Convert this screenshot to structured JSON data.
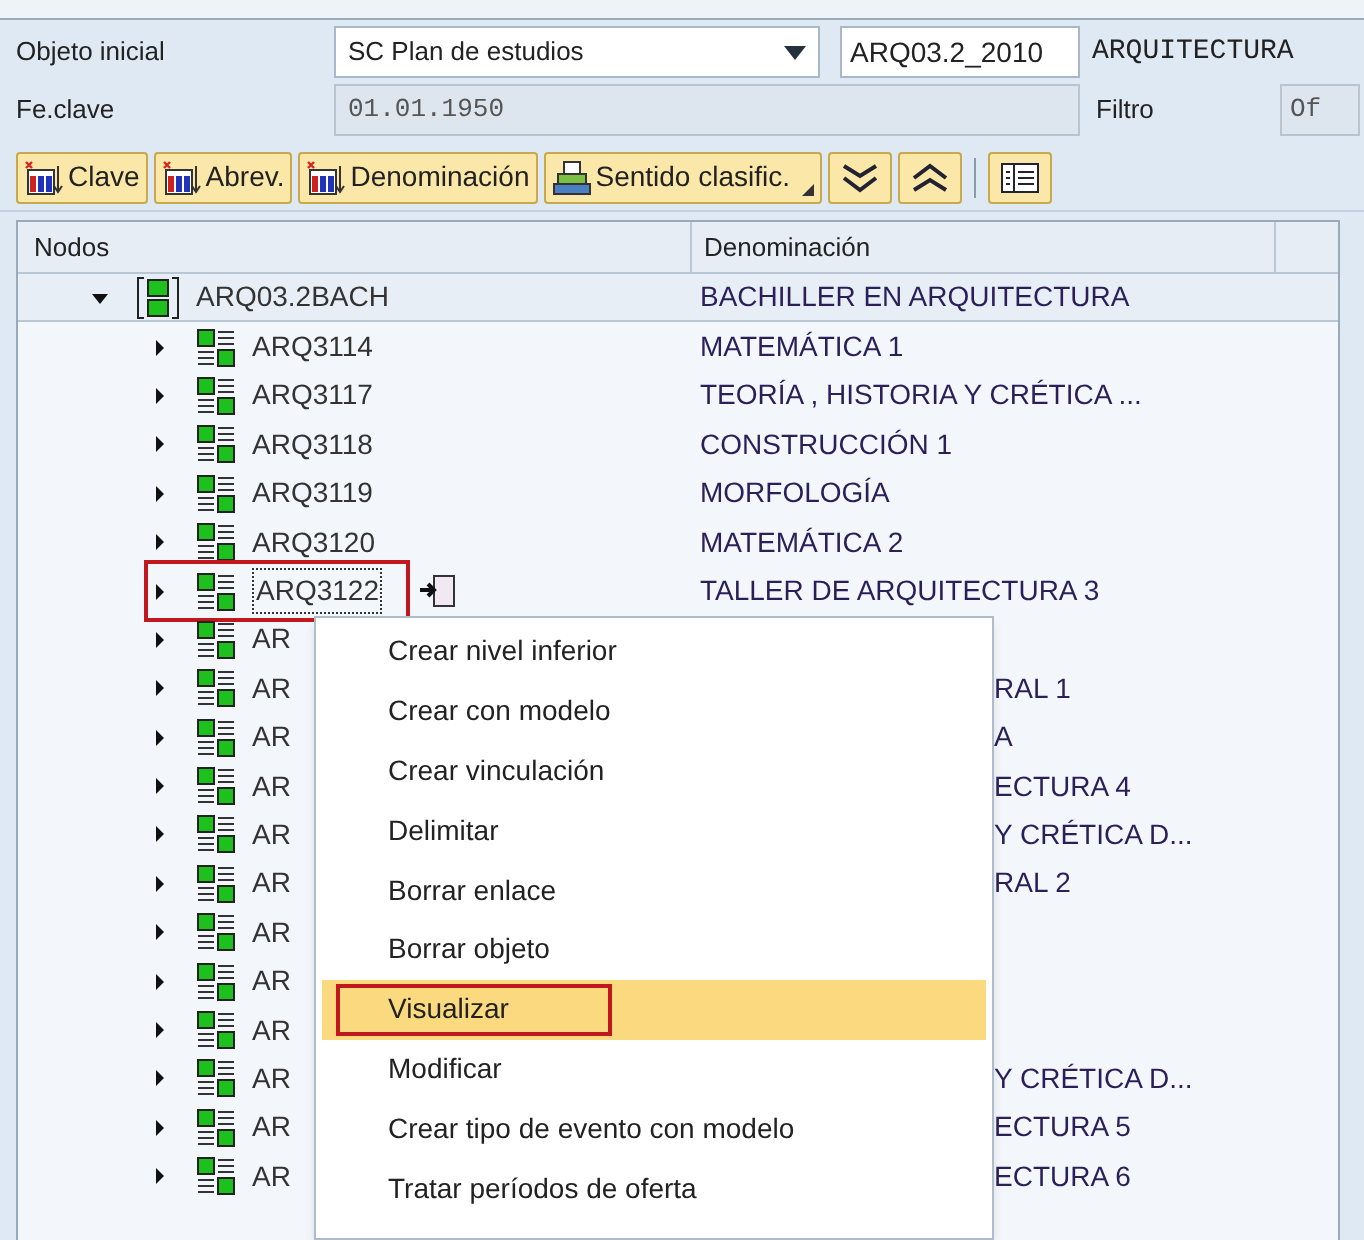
{
  "form": {
    "start_object_label": "Objeto inicial",
    "object_type": "SC Plan de estudios",
    "object_id": "ARQ03.2_2010",
    "object_name": "ARQUITECTURA",
    "key_date_label": "Fe.clave",
    "key_date": "01.01.1950",
    "filter_label": "Filtro",
    "filter_value": "Of"
  },
  "toolbar": [
    {
      "kind": "sort",
      "label": "Clave"
    },
    {
      "kind": "sort",
      "label": "Abrev."
    },
    {
      "kind": "sort",
      "label": "Denominación"
    },
    {
      "kind": "direction",
      "label": "Sentido clasific."
    },
    {
      "kind": "expand"
    },
    {
      "kind": "collapse"
    },
    {
      "kind": "separator"
    },
    {
      "kind": "layout"
    }
  ],
  "tree": {
    "columns": [
      "Nodos",
      "Denominación"
    ],
    "nodes": [
      {
        "code": "ARQ03.2BACH",
        "description": "BACHILLER EN ARQUITECTURA",
        "expanded": true,
        "highlighted": false,
        "obscured": false,
        "children": [
          {
            "code": "ARQ3114",
            "description": "MATEMÁTICA 1",
            "expanded": false,
            "highlighted": false,
            "obscured": false
          },
          {
            "code": "ARQ3117",
            "description": "TEORÍA , HISTORIA Y CRÉTICA ...",
            "expanded": false,
            "highlighted": false,
            "obscured": false
          },
          {
            "code": "ARQ3118",
            "description": "CONSTRUCCIÓN 1",
            "expanded": false,
            "highlighted": false,
            "obscured": false
          },
          {
            "code": "ARQ3119",
            "description": "MORFOLOGÍA",
            "expanded": false,
            "highlighted": false,
            "obscured": false
          },
          {
            "code": "ARQ3120",
            "description": "MATEMÁTICA 2",
            "expanded": false,
            "highlighted": false,
            "obscured": false
          },
          {
            "code": "ARQ3122",
            "description": "TALLER DE ARQUITECTURA 3",
            "expanded": false,
            "highlighted": true,
            "obscured": false
          },
          {
            "code": "AR",
            "expanded": false,
            "highlighted": false,
            "obscured": true
          },
          {
            "code": "AR",
            "description": "RAL 1",
            "expanded": false,
            "highlighted": false,
            "obscured": true
          },
          {
            "code": "AR",
            "description": "A",
            "expanded": false,
            "highlighted": false,
            "obscured": true
          },
          {
            "code": "AR",
            "description": "ECTURA 4",
            "expanded": false,
            "highlighted": false,
            "obscured": true
          },
          {
            "code": "AR",
            "description": "Y CRÉTICA D...",
            "expanded": false,
            "highlighted": false,
            "obscured": true
          },
          {
            "code": "AR",
            "description": "RAL 2",
            "expanded": false,
            "highlighted": false,
            "obscured": true
          },
          {
            "code": "AR",
            "expanded": false,
            "highlighted": false,
            "obscured": true
          },
          {
            "code": "AR",
            "expanded": false,
            "highlighted": false,
            "obscured": true
          },
          {
            "code": "AR",
            "expanded": false,
            "highlighted": false,
            "obscured": true
          },
          {
            "code": "AR",
            "description": "Y CRÉTICA D...",
            "expanded": false,
            "highlighted": false,
            "obscured": true
          },
          {
            "code": "AR",
            "description": "ECTURA 5",
            "expanded": false,
            "highlighted": false,
            "obscured": true
          },
          {
            "code": "AR",
            "description": "ECTURA 6",
            "expanded": false,
            "highlighted": false,
            "obscured": true
          }
        ]
      }
    ]
  },
  "context_menu": [
    {
      "label": "Crear nivel inferior",
      "selected": false,
      "highlighted": false
    },
    {
      "label": "Crear con modelo",
      "selected": false,
      "highlighted": false
    },
    {
      "label": "Crear vinculación",
      "selected": false,
      "highlighted": false
    },
    {
      "label": "Delimitar",
      "selected": false,
      "highlighted": false
    },
    {
      "label": "Borrar enlace",
      "selected": false,
      "highlighted": false
    },
    {
      "label": "Borrar objeto",
      "selected": false,
      "highlighted": false
    },
    {
      "label": "Visualizar",
      "selected": true,
      "highlighted": true
    },
    {
      "label": "Modificar",
      "selected": false,
      "highlighted": false
    },
    {
      "label": "Crear tipo de evento con modelo",
      "selected": false,
      "highlighted": false
    },
    {
      "label": "Tratar períodos de oferta",
      "selected": false,
      "highlighted": false
    }
  ]
}
